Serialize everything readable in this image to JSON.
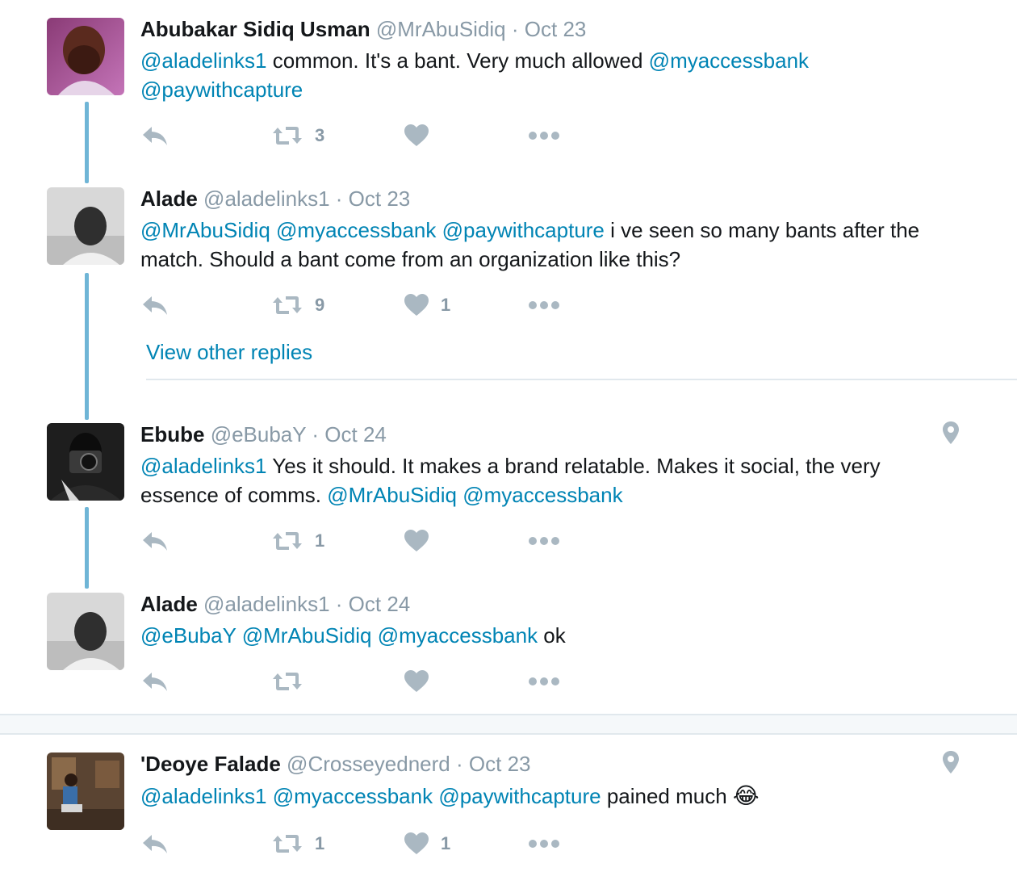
{
  "tweets": [
    {
      "name": "Abubakar Sidiq Usman",
      "handle": "@MrAbuSidiq",
      "separator": "·",
      "time": "Oct 23",
      "body": [
        {
          "text": "@aladelinks1",
          "mention": true
        },
        {
          "text": " common. It's a bant.  Very much allowed ",
          "mention": false
        },
        {
          "text": "@myaccessbank",
          "mention": true
        },
        {
          "text": " ",
          "mention": false
        },
        {
          "text": "@paywithcapture",
          "mention": true
        }
      ],
      "retweet_count": "3",
      "like_count": ""
    },
    {
      "name": "Alade",
      "handle": "@aladelinks1",
      "separator": "·",
      "time": "Oct 23",
      "body": [
        {
          "text": "@MrAbuSidiq",
          "mention": true
        },
        {
          "text": " ",
          "mention": false
        },
        {
          "text": "@myaccessbank",
          "mention": true
        },
        {
          "text": " ",
          "mention": false
        },
        {
          "text": "@paywithcapture",
          "mention": true
        },
        {
          "text": "  i ve seen so many bants after the match. Should a bant come from an organization like this?",
          "mention": false
        }
      ],
      "retweet_count": "9",
      "like_count": "1"
    },
    {
      "name": "Ebube",
      "handle": "@eBubaY",
      "separator": "·",
      "time": "Oct 24",
      "body": [
        {
          "text": "@aladelinks1",
          "mention": true
        },
        {
          "text": " Yes it should. It makes a brand relatable. Makes it social, the very essence of comms. ",
          "mention": false
        },
        {
          "text": "@MrAbuSidiq",
          "mention": true
        },
        {
          "text": " ",
          "mention": false
        },
        {
          "text": "@myaccessbank",
          "mention": true
        }
      ],
      "retweet_count": "1",
      "like_count": ""
    },
    {
      "name": "Alade",
      "handle": "@aladelinks1",
      "separator": "·",
      "time": "Oct 24",
      "body": [
        {
          "text": "@eBubaY",
          "mention": true
        },
        {
          "text": " ",
          "mention": false
        },
        {
          "text": "@MrAbuSidiq",
          "mention": true
        },
        {
          "text": " ",
          "mention": false
        },
        {
          "text": "@myaccessbank",
          "mention": true
        },
        {
          "text": " ok",
          "mention": false
        }
      ],
      "retweet_count": "",
      "like_count": ""
    },
    {
      "name": "'Deoye Falade",
      "handle": "@Crosseyednerd",
      "separator": "·",
      "time": "Oct 23",
      "body": [
        {
          "text": "@aladelinks1",
          "mention": true
        },
        {
          "text": " ",
          "mention": false
        },
        {
          "text": "@myaccessbank",
          "mention": true
        },
        {
          "text": " ",
          "mention": false
        },
        {
          "text": "@paywithcapture",
          "mention": true
        },
        {
          "text": " pained much ",
          "mention": false
        },
        {
          "text": "😂",
          "mention": false,
          "emoji": true
        }
      ],
      "retweet_count": "1",
      "like_count": "1"
    }
  ],
  "view_other_replies": "View other replies",
  "icons": {
    "reply": "reply-icon",
    "retweet": "retweet-icon",
    "like": "heart-icon",
    "more": "more-dots-icon",
    "geo": "location-pin-icon"
  },
  "colors": {
    "mention": "#0084b4",
    "muted": "#8899a6",
    "thread_line": "#6fb5d6"
  }
}
